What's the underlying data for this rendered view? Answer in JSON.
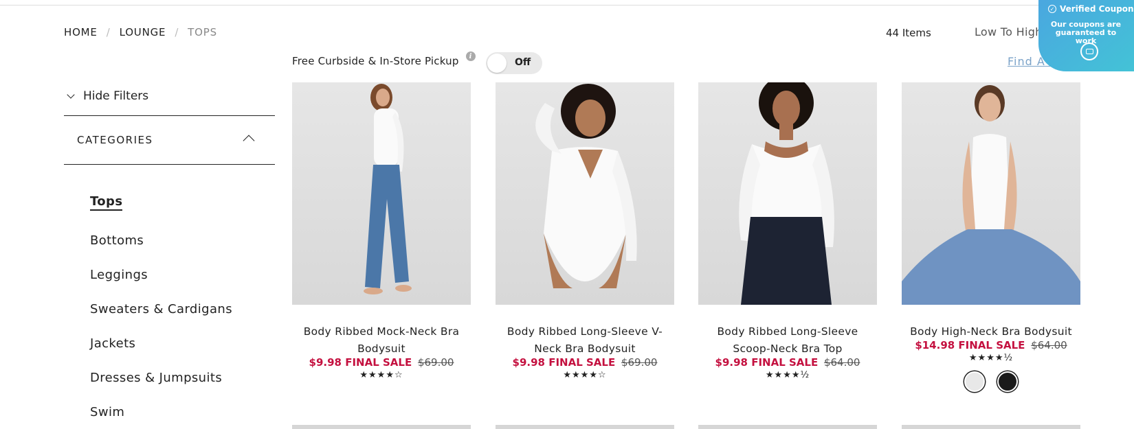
{
  "breadcrumb": {
    "home": "HOME",
    "lounge": "LOUNGE",
    "current": "TOPS",
    "separator": "/"
  },
  "toolbar": {
    "items_count": "44 Items",
    "sort": "Low To High"
  },
  "coupon": {
    "title": "Verified Coupon",
    "text": "Our coupons are guaranteed to work",
    "icon": "chat-icon"
  },
  "pickup": {
    "label": "Free Curbside & In-Store Pickup",
    "info": "i",
    "toggle_state": "Off"
  },
  "find_store": "Find A Store",
  "sidebar": {
    "hide_filters": "Hide Filters",
    "categories_header": "CATEGORIES",
    "items": [
      {
        "label": "Tops",
        "active": true
      },
      {
        "label": "Bottoms"
      },
      {
        "label": "Leggings"
      },
      {
        "label": "Sweaters & Cardigans"
      },
      {
        "label": "Jackets"
      },
      {
        "label": "Dresses & Jumpsuits"
      },
      {
        "label": "Swim"
      }
    ]
  },
  "products": [
    {
      "name": "Body Ribbed Mock-Neck Bra Bodysuit",
      "sale": "$9.98 FINAL SALE",
      "original": "$69.00",
      "rating": 4,
      "stars": "★★★★☆"
    },
    {
      "name": "Body Ribbed Long-Sleeve V-Neck Bra Bodysuit",
      "sale": "$9.98 FINAL SALE",
      "original": "$69.00",
      "rating": 4,
      "stars": "★★★★☆"
    },
    {
      "name": "Body Ribbed Long-Sleeve Scoop-Neck Bra Top",
      "sale": "$9.98 FINAL SALE",
      "original": "$64.00",
      "rating": 4.5,
      "stars": "★★★★½"
    },
    {
      "name": "Body High-Neck Bra Bodysuit",
      "sale": "$14.98 FINAL SALE",
      "original": "$64.00",
      "rating": 4.5,
      "stars": "★★★★½",
      "swatches": [
        "#e8e8e8",
        "#1a1a1a"
      ]
    }
  ],
  "colors": {
    "sale": "#c4103f",
    "link": "#7ba3c9",
    "coupon": "#4aa6e0"
  }
}
